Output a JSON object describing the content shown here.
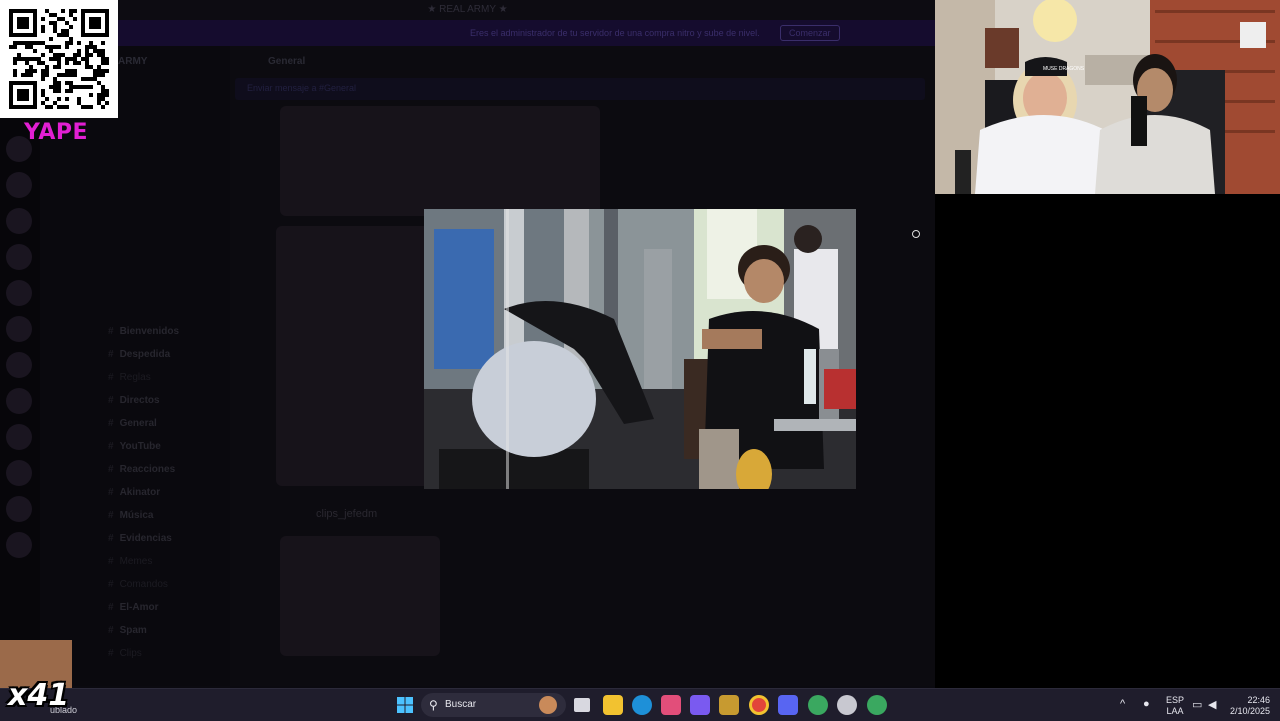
{
  "discord": {
    "window_title": "★ REAL ARMY ★",
    "banner_text": "Eres el administrador de tu servidor de una compra nitro y sube de nivel.",
    "banner_button": "Comenzar",
    "server_name": "ARMY",
    "channel_header": "General",
    "message_placeholder": "Enviar mensaje a #General",
    "channels": [
      {
        "label": "Bienvenidos",
        "bold": true
      },
      {
        "label": "Despedida",
        "bold": true
      },
      {
        "label": "Reglas",
        "bold": false
      },
      {
        "label": "Directos",
        "bold": true
      },
      {
        "label": "General",
        "bold": true
      },
      {
        "label": "YouTube",
        "bold": true
      },
      {
        "label": "Reacciones",
        "bold": true
      },
      {
        "label": "Akinator",
        "bold": true
      },
      {
        "label": "Música",
        "bold": true
      },
      {
        "label": "Evidencias",
        "bold": true
      },
      {
        "label": "Memes",
        "bold": false
      },
      {
        "label": "Comandos",
        "bold": false
      },
      {
        "label": "El-Amor",
        "bold": true
      },
      {
        "label": "Spam",
        "bold": true
      },
      {
        "label": "Clips",
        "bold": false
      }
    ],
    "clip_name": "clips_jefedm"
  },
  "overlay": {
    "yape_label": "YAPE",
    "multiplier": "x41",
    "bottom_left_text": "ublado"
  },
  "webcam": {
    "cap_text": "MUSE DRAGONS"
  },
  "taskbar": {
    "search_label": "Buscar",
    "language_line1": "ESP",
    "language_line2": "LAA",
    "time": "22:46",
    "date": "2/10/2025",
    "icons": [
      "windows-start-icon",
      "search-icon",
      "task-view-icon",
      "file-explorer-icon",
      "edge-icon",
      "snipping-tool-icon",
      "copilot-icon",
      "game-icon",
      "chrome-icon",
      "discord-icon",
      "chrome-profile-icon",
      "github-desktop-icon",
      "chrome-alt-icon"
    ]
  },
  "colors": {
    "yape": "#e21fd3",
    "taskbar": "#1f1d2c",
    "banner": "#150c2e"
  }
}
